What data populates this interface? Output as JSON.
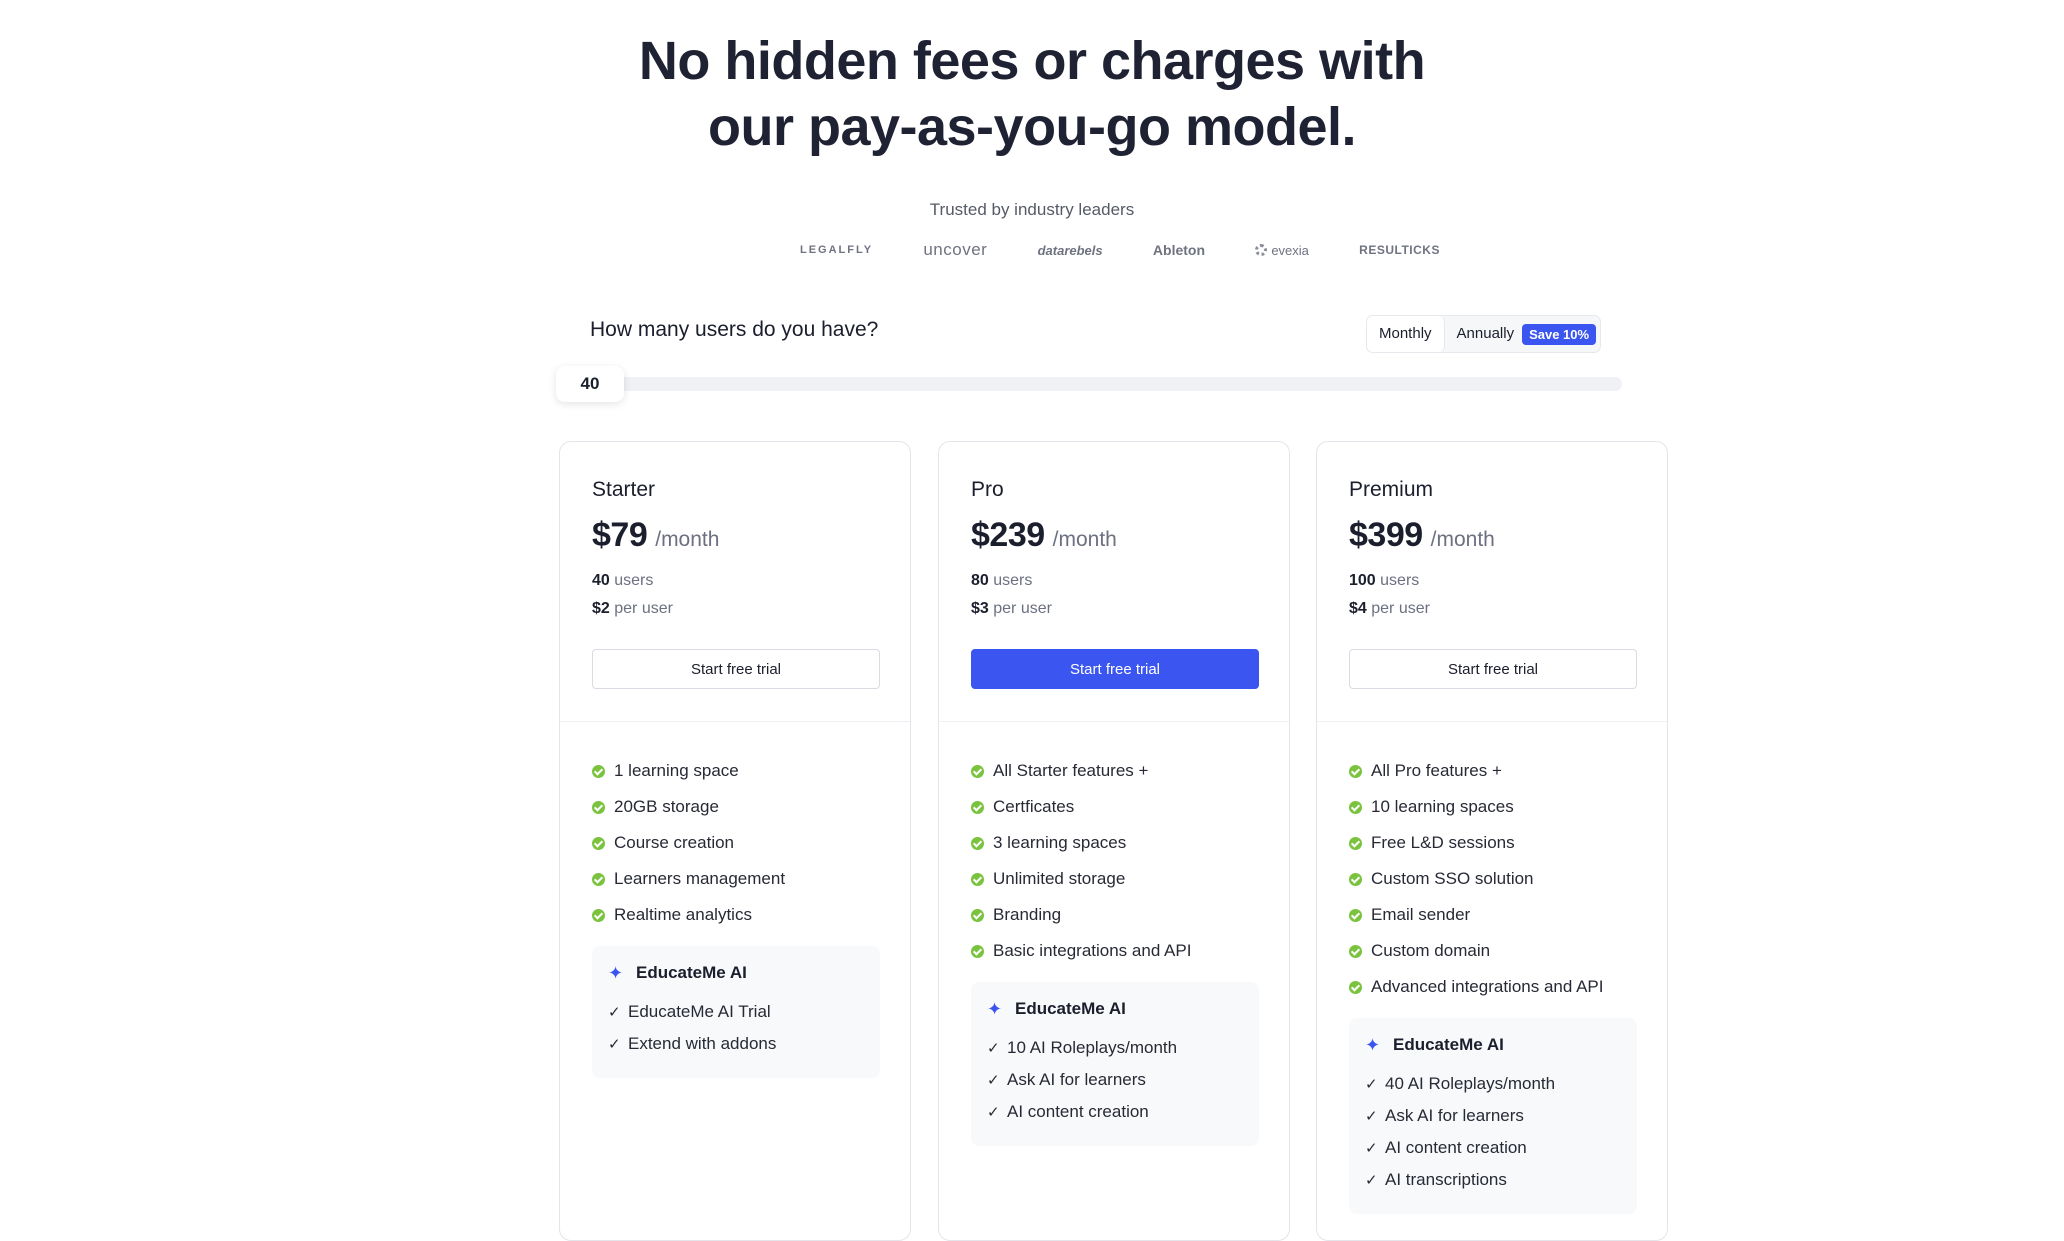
{
  "hero": {
    "line1": "No hidden fees or charges with",
    "line2": "our pay-as-you-go model."
  },
  "trusted": {
    "label": "Trusted by industry leaders",
    "logos": [
      "LEGALFLY",
      "uncover",
      "datarebels",
      "Ableton",
      "evexia",
      "RESULTICKS"
    ]
  },
  "users_question": "How many users do you have?",
  "billing": {
    "monthly": "Monthly",
    "annually": "Annually",
    "save_badge": "Save 10%",
    "selected": "Monthly"
  },
  "slider": {
    "value": "40"
  },
  "colors": {
    "accent": "#3b55f0",
    "check": "#7ac33e",
    "text": "#1b1e2c"
  },
  "plans": [
    {
      "name": "Starter",
      "price": "$79",
      "period": "/month",
      "users_count": "40",
      "users_label": " users",
      "per_user_price": "$2",
      "per_user_label": " per user",
      "cta": "Start free trial",
      "features": [
        "1 learning space",
        "20GB storage",
        "Course creation",
        "Learners management",
        "Realtime analytics"
      ],
      "ai_title": "EducateMe AI",
      "ai_features": [
        "EducateMe AI Trial",
        "Extend with addons"
      ]
    },
    {
      "name": "Pro",
      "price": "$239",
      "period": "/month",
      "users_count": "80",
      "users_label": " users",
      "per_user_price": "$3",
      "per_user_label": " per user",
      "cta": "Start free trial",
      "features": [
        "All Starter features +",
        "Certficates",
        "3 learning spaces",
        "Unlimited storage",
        "Branding",
        "Basic integrations  and API"
      ],
      "ai_title": "EducateMe AI",
      "ai_features": [
        "10 AI Roleplays/month",
        "Ask AI for learners",
        "AI content creation"
      ]
    },
    {
      "name": "Premium",
      "price": "$399",
      "period": "/month",
      "users_count": "100",
      "users_label": " users",
      "per_user_price": "$4",
      "per_user_label": " per user",
      "cta": "Start free trial",
      "features": [
        "All Pro features +",
        "10 learning spaces",
        "Free L&D sessions",
        "Custom SSO solution",
        "Email sender",
        "Custom domain",
        "Advanced integrations and API"
      ],
      "ai_title": "EducateMe AI",
      "ai_features": [
        "40 AI Roleplays/month",
        "Ask AI for learners",
        "AI content creation",
        "AI transcriptions"
      ]
    }
  ]
}
